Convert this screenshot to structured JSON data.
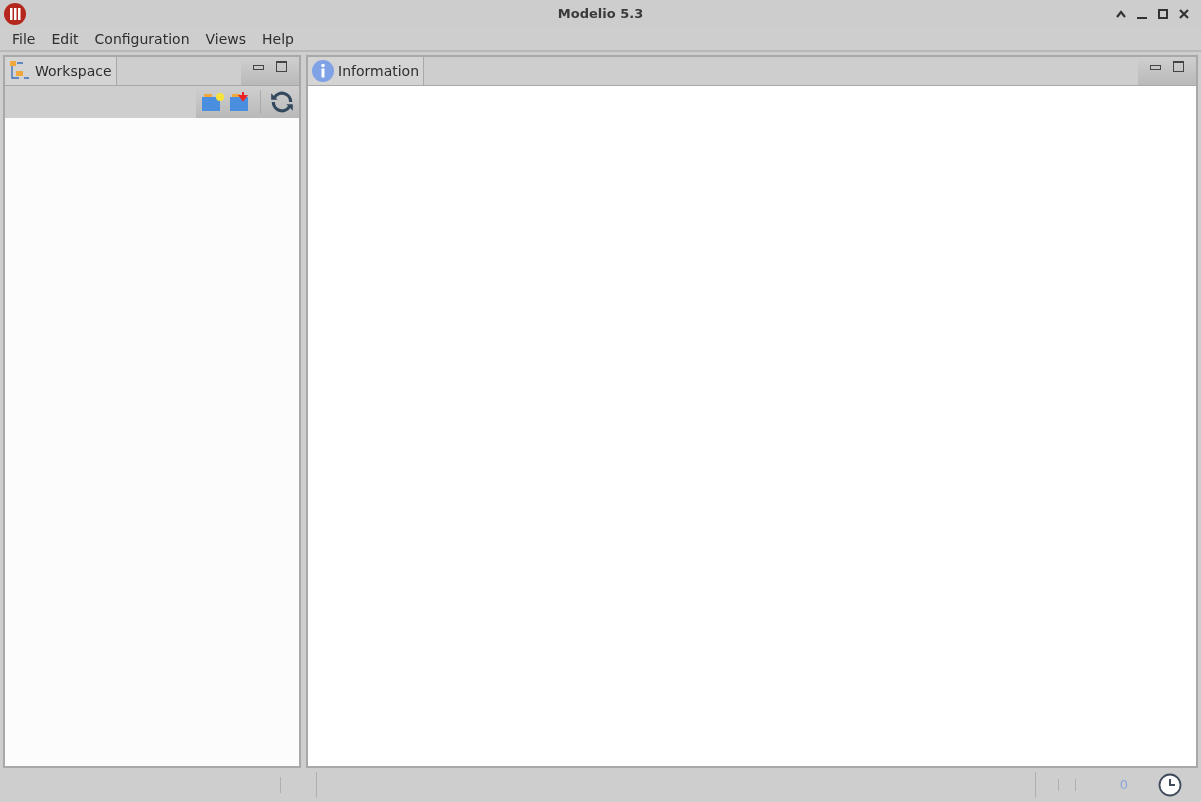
{
  "window": {
    "title": "Modelio 5.3"
  },
  "menu": [
    "File",
    "Edit",
    "Configuration",
    "Views",
    "Help"
  ],
  "left_panel": {
    "tab": "Workspace"
  },
  "right_panel": {
    "tab": "Information"
  },
  "status_bar": {
    "count": "0"
  }
}
